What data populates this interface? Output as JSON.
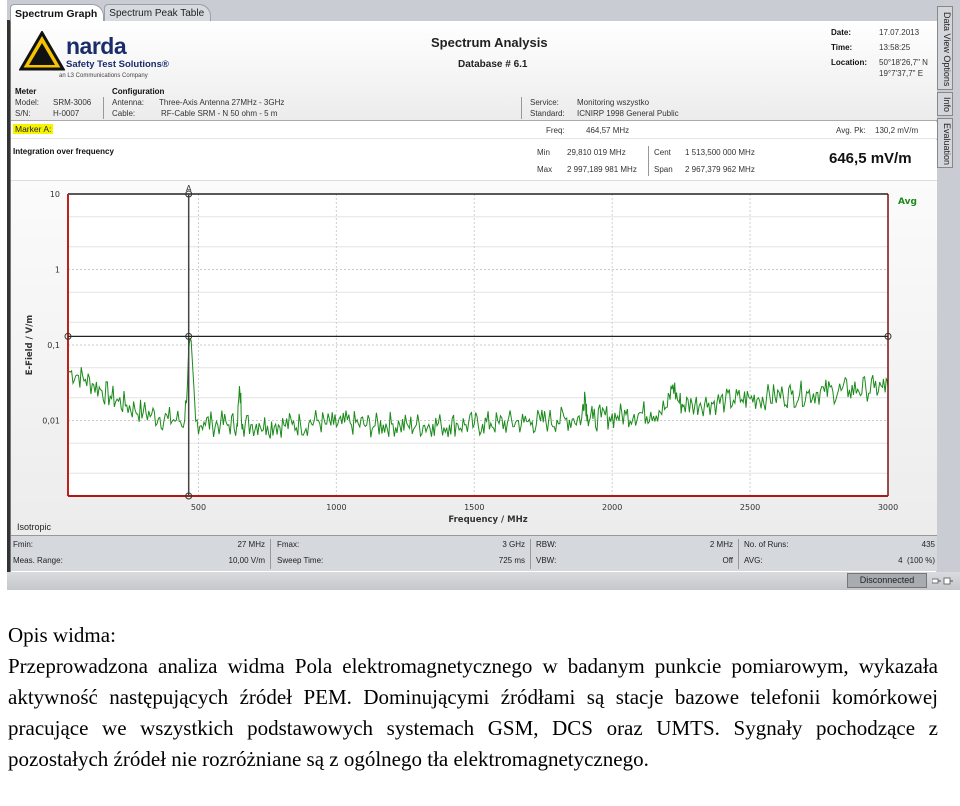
{
  "tabs": [
    {
      "label": "Spectrum Graph",
      "active": true
    },
    {
      "label": "Spectrum Peak Table",
      "active": false
    }
  ],
  "side_tabs": [
    "Data View Options",
    "Info",
    "Evaluation"
  ],
  "logo": {
    "word": "narda",
    "subtitle": "Safety Test Solutions®",
    "company": "an L3 Communications Company"
  },
  "header": {
    "title": "Spectrum Analysis",
    "database": "Database # 6.1",
    "date_label": "Date:",
    "date": "17.07.2013",
    "time_label": "Time:",
    "time": "13:58:25",
    "location_label": "Location:",
    "location_n": "50°18'26,7\" N",
    "location_e": "19°7'37,7\" E",
    "meter_heading": "Meter",
    "model_label": "Model:",
    "model": "SRM-3006",
    "sn_label": "S/N:",
    "sn": "H-0007",
    "config_heading": "Configuration",
    "antenna_label": "Antenna:",
    "antenna": "Three-Axis Antenna 27MHz - 3GHz",
    "cable_label": "Cable:",
    "cable": "RF-Cable SRM - N 50 ohm - 5 m",
    "service_label": "Service:",
    "service": "Monitoring wszystko",
    "standard_label": "Standard:",
    "standard": "ICNIRP 1998 General Public"
  },
  "marker": {
    "label": "Marker A:",
    "freq_label": "Freq:",
    "freq": "464,57 MHz",
    "avgpk_label": "Avg. Pk:",
    "avgpk": "130,2 mV/m"
  },
  "integration": {
    "title": "Integration over frequency",
    "min_label": "Min",
    "min": "29,810 019 MHz",
    "max_label": "Max",
    "max": "2 997,189 981 MHz",
    "cent_label": "Cent",
    "cent": "1 513,500 000 MHz",
    "span_label": "Span",
    "span": "2 967,379 962 MHz",
    "result": "646,5 mV/m"
  },
  "chart_data": {
    "type": "line",
    "title": "",
    "xlabel": "Frequency / MHz",
    "ylabel": "E-Field / V/m",
    "xlim": [
      27,
      3000
    ],
    "ylim": [
      0.001,
      10
    ],
    "yscale": "log",
    "xticks": [
      "500",
      "1000",
      "1500",
      "2000",
      "2500",
      "3000"
    ],
    "xtick_values": [
      500,
      1000,
      1500,
      2000,
      2500,
      3000
    ],
    "yticks": [
      "10",
      "1",
      "0,1",
      "0,01"
    ],
    "ytick_values": [
      10,
      1,
      0.1,
      0.01
    ],
    "legend": [
      "Avg"
    ],
    "legend_position": "top-right",
    "marker": {
      "name": "A",
      "x": 464.57,
      "y": 0.1302
    },
    "series": [
      {
        "name": "Avg",
        "color": "#1a8a1a",
        "x": [
          30,
          60,
          90,
          120,
          150,
          180,
          210,
          240,
          270,
          300,
          330,
          360,
          390,
          420,
          450,
          470,
          490,
          520,
          550,
          580,
          610,
          640,
          650,
          660,
          690,
          720,
          750,
          780,
          810,
          840,
          870,
          900,
          930,
          960,
          990,
          1020,
          1050,
          1080,
          1110,
          1140,
          1170,
          1200,
          1230,
          1260,
          1290,
          1320,
          1350,
          1380,
          1410,
          1440,
          1470,
          1500,
          1530,
          1560,
          1590,
          1620,
          1650,
          1680,
          1710,
          1740,
          1770,
          1800,
          1830,
          1860,
          1890,
          1900,
          1910,
          1930,
          1960,
          1990,
          2020,
          2050,
          2080,
          2110,
          2140,
          2170,
          2200,
          2220,
          2240,
          2260,
          2290,
          2320,
          2350,
          2380,
          2410,
          2440,
          2470,
          2500,
          2530,
          2560,
          2590,
          2620,
          2650,
          2680,
          2710,
          2740,
          2770,
          2800,
          2830,
          2860,
          2890,
          2920,
          2950,
          2980,
          3000
        ],
        "values": [
          0.045,
          0.04,
          0.035,
          0.03,
          0.025,
          0.021,
          0.018,
          0.016,
          0.014,
          0.013,
          0.012,
          0.011,
          0.0105,
          0.0102,
          0.01,
          0.12,
          0.0098,
          0.0095,
          0.009,
          0.0092,
          0.0088,
          0.0093,
          0.025,
          0.009,
          0.0088,
          0.0092,
          0.0085,
          0.009,
          0.0087,
          0.0089,
          0.009,
          0.0092,
          0.01,
          0.009,
          0.0088,
          0.009,
          0.0092,
          0.009,
          0.0087,
          0.0085,
          0.0088,
          0.009,
          0.0087,
          0.0085,
          0.0088,
          0.0086,
          0.009,
          0.0087,
          0.0088,
          0.009,
          0.0088,
          0.0089,
          0.009,
          0.0092,
          0.0091,
          0.0093,
          0.0095,
          0.0094,
          0.0096,
          0.0098,
          0.01,
          0.0102,
          0.0104,
          0.0106,
          0.011,
          0.024,
          0.012,
          0.0105,
          0.011,
          0.0112,
          0.0115,
          0.012,
          0.0122,
          0.0125,
          0.013,
          0.0135,
          0.015,
          0.03,
          0.018,
          0.016,
          0.0165,
          0.017,
          0.0172,
          0.0175,
          0.018,
          0.0185,
          0.019,
          0.0195,
          0.02,
          0.0205,
          0.021,
          0.0215,
          0.022,
          0.0225,
          0.023,
          0.0235,
          0.024,
          0.0245,
          0.025,
          0.0255,
          0.026,
          0.0265,
          0.027,
          0.0275,
          0.028
        ]
      }
    ],
    "grid": true,
    "antenna_mode": "Isotropic"
  },
  "status": {
    "fmin_label": "Fmin:",
    "fmin": "27 MHz",
    "range_label": "Meas. Range:",
    "range": "10,00 V/m",
    "fmax_label": "Fmax:",
    "fmax": "3 GHz",
    "sweep_label": "Sweep Time:",
    "sweep": "725 ms",
    "rbw_label": "RBW:",
    "rbw": "2 MHz",
    "vbw_label": "VBW:",
    "vbw": "Off",
    "runs_label": "No. of Runs:",
    "runs": "435",
    "avg_label": "AVG:",
    "avg": "4  (100 %)",
    "connection": "Disconnected"
  },
  "description": {
    "heading": "Opis widma:",
    "body": "Przeprowadzona analiza widma Pola elektromagnetycznego w badanym punkcie pomiarowym, wykazała aktywność następujących źródeł PEM. Dominującymi źródłami są stacje bazowe telefonii komórkowej pracujące we wszystkich podstawowych systemach GSM, DCS oraz UMTS. Sygnały pochodzące z pozostałych źródeł nie rozróżniane są z ogólnego tła elektromagnetycznego."
  }
}
